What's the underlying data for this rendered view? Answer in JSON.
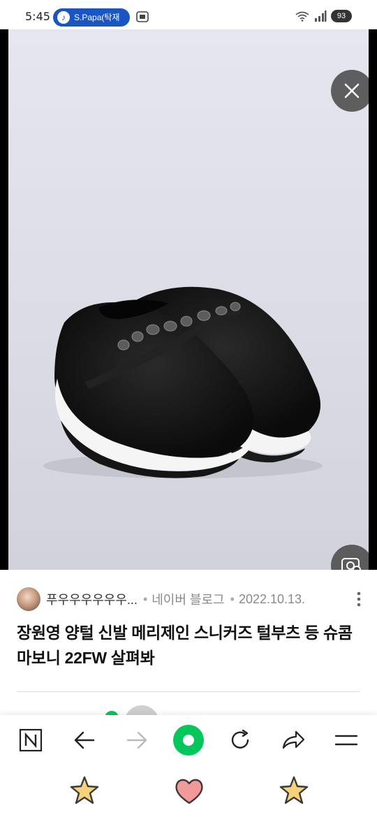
{
  "status_bar": {
    "time": "5:45",
    "music_chip_label": "S.Papa(탁재",
    "battery_level": "93"
  },
  "viewer": {
    "image_subject": "black fleece mary jane sneakers with jeweled strap",
    "close_icon": "close-icon",
    "lens_icon": "image-search-icon"
  },
  "article": {
    "author": "푸우우우우우우...",
    "separator": "•",
    "source": "네이버 블로그",
    "date": "2022.10.13.",
    "title": "장원영 양털 신발 메리제인 스니커즈 털부츠 등 슈콤마보니 22FW 살펴봐"
  },
  "bottom_nav": {
    "items": [
      "naver-home-icon",
      "back-arrow-icon",
      "forward-arrow-icon",
      "green-dot-button",
      "refresh-icon",
      "share-icon",
      "menu-icon"
    ],
    "green_accent": "#03c75a"
  },
  "colors": {
    "accent_blue": "#1a55c4",
    "brand_green": "#03c75a"
  }
}
